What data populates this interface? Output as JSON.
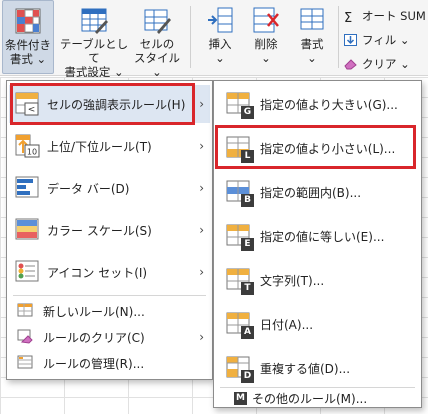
{
  "ribbon": {
    "conditional_formatting": "条件付き\n書式 ⌄",
    "format_as_table": "テーブルとして\n書式設定 ⌄",
    "cell_styles": "セルの\nスタイル ⌄",
    "insert": "挿入\n⌄",
    "delete": "削除\n⌄",
    "format": "書式\n⌄",
    "autosum": "オート SUM",
    "fill": "フィル ⌄",
    "clear": "クリア ⌄"
  },
  "main_menu": {
    "items": [
      {
        "label": "セルの強調表示ルール(H)",
        "icon": "highlight-rules-icon"
      },
      {
        "label": "上位/下位ルール(T)",
        "icon": "top-bottom-icon",
        "badge": "10"
      },
      {
        "label": "データ バー(D)",
        "icon": "data-bars-icon"
      },
      {
        "label": "カラー スケール(S)",
        "icon": "color-scales-icon"
      },
      {
        "label": "アイコン セット(I)",
        "icon": "icon-sets-icon"
      },
      {
        "label": "新しいルール(N)...",
        "icon": "new-rule-icon"
      },
      {
        "label": "ルールのクリア(C)",
        "icon": "clear-rules-icon"
      },
      {
        "label": "ルールの管理(R)...",
        "icon": "manage-rules-icon"
      }
    ]
  },
  "sub_menu": {
    "items": [
      {
        "label": "指定の値より大きい(G)...",
        "badge": "G"
      },
      {
        "label": "指定の値より小さい(L)...",
        "badge": "L"
      },
      {
        "label": "指定の範囲内(B)...",
        "badge": "B"
      },
      {
        "label": "指定の値に等しい(E)...",
        "badge": "E"
      },
      {
        "label": "文字列(T)...",
        "badge": "T"
      },
      {
        "label": "日付(A)...",
        "badge": "A"
      },
      {
        "label": "重複する値(D)...",
        "badge": "D"
      },
      {
        "label": "その他のルール(M)...",
        "badge": "M"
      }
    ]
  },
  "colors": {
    "highlight_red": "#d9262b",
    "menu_border": "#8c8c8c",
    "icon_blue": "#2f6fbf",
    "icon_orange": "#f0a030"
  }
}
